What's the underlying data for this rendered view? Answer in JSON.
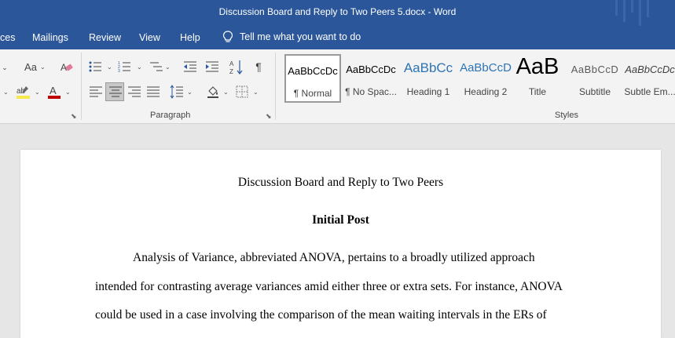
{
  "window": {
    "title": "Discussion Board and Reply to Two Peers 5.docx  -  Word"
  },
  "menu": {
    "tabs": [
      "ces",
      "Mailings",
      "Review",
      "View",
      "Help"
    ],
    "tell_me": "Tell me what you want to do"
  },
  "ribbon": {
    "paragraph_label": "Paragraph",
    "styles_label": "Styles",
    "styles": [
      {
        "sample": "AaBbCcDc",
        "name": "¶ Normal",
        "selected": true
      },
      {
        "sample": "AaBbCcDc",
        "name": "¶ No Spac...",
        "selected": false
      },
      {
        "sample": "AaBbCc",
        "name": "Heading 1",
        "selected": false
      },
      {
        "sample": "AaBbCcD",
        "name": "Heading 2",
        "selected": false
      },
      {
        "sample": "AaB",
        "name": "Title",
        "selected": false
      },
      {
        "sample": "AaBbCcD",
        "name": "Subtitle",
        "selected": false
      },
      {
        "sample": "AaBbCcDc",
        "name": "Subtle Em...",
        "selected": false
      }
    ],
    "colors": {
      "highlight": "#f6e94a",
      "font_color": "#c00000"
    }
  },
  "document": {
    "heading": "Discussion Board and Reply to Two Peers",
    "subheading": "Initial Post",
    "lines": [
      "Analysis of Variance, abbreviated ANOVA, pertains to a broadly utilized approach",
      "intended for contrasting average variances amid either three or extra sets. For instance, ANOVA",
      "could be used in a case involving the comparison of the mean waiting intervals in the ERs of"
    ]
  }
}
